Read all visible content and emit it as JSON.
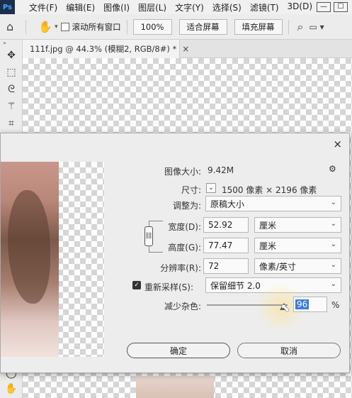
{
  "menu": {
    "logo": "Ps",
    "items": [
      "文件(F)",
      "编辑(E)",
      "图像(I)",
      "图层(L)",
      "文字(Y)",
      "选择(S)",
      "滤镜(T)",
      "3D(D)"
    ],
    "window_buttons": [
      "—",
      "☐"
    ]
  },
  "options": {
    "scroll_all_label": "滚动所有窗口",
    "zoom_value": "100%",
    "fit_screen_label": "适合屏幕",
    "fill_screen_label": "填充屏幕"
  },
  "tab": {
    "title": "111f.jpg @ 44.3% (模糊2, RGB/8#) *",
    "close": "×"
  },
  "dialog": {
    "close": "×",
    "image_size_label": "图像大小:",
    "image_size_value": "9.42M",
    "dimensions_label": "尺寸:",
    "dimensions_value": "1500 像素 × 2196 像素",
    "fit_to_label": "调整为:",
    "fit_to_value": "原稿大小",
    "width_label": "宽度(D):",
    "width_value": "52.92",
    "width_unit": "厘米",
    "height_label": "高度(G):",
    "height_value": "77.47",
    "height_unit": "厘米",
    "resolution_label": "分辨率(R):",
    "resolution_value": "72",
    "resolution_unit": "像素/英寸",
    "resample_label": "重新采样(S):",
    "resample_value": "保留细节 2.0",
    "resample_checked": true,
    "noise_label": "减少杂色:",
    "noise_value": "96",
    "noise_unit": "%",
    "noise_level": 0.96,
    "ok_label": "确定",
    "cancel_label": "取消"
  },
  "colors": {
    "accent_selection": "#3b7bd8",
    "dialog_bg": "#ededed"
  },
  "icons": {
    "home": "home-icon",
    "hand": "hand-icon",
    "search": "search-icon",
    "gear": "gear-icon",
    "chain": "chain-link-icon"
  }
}
